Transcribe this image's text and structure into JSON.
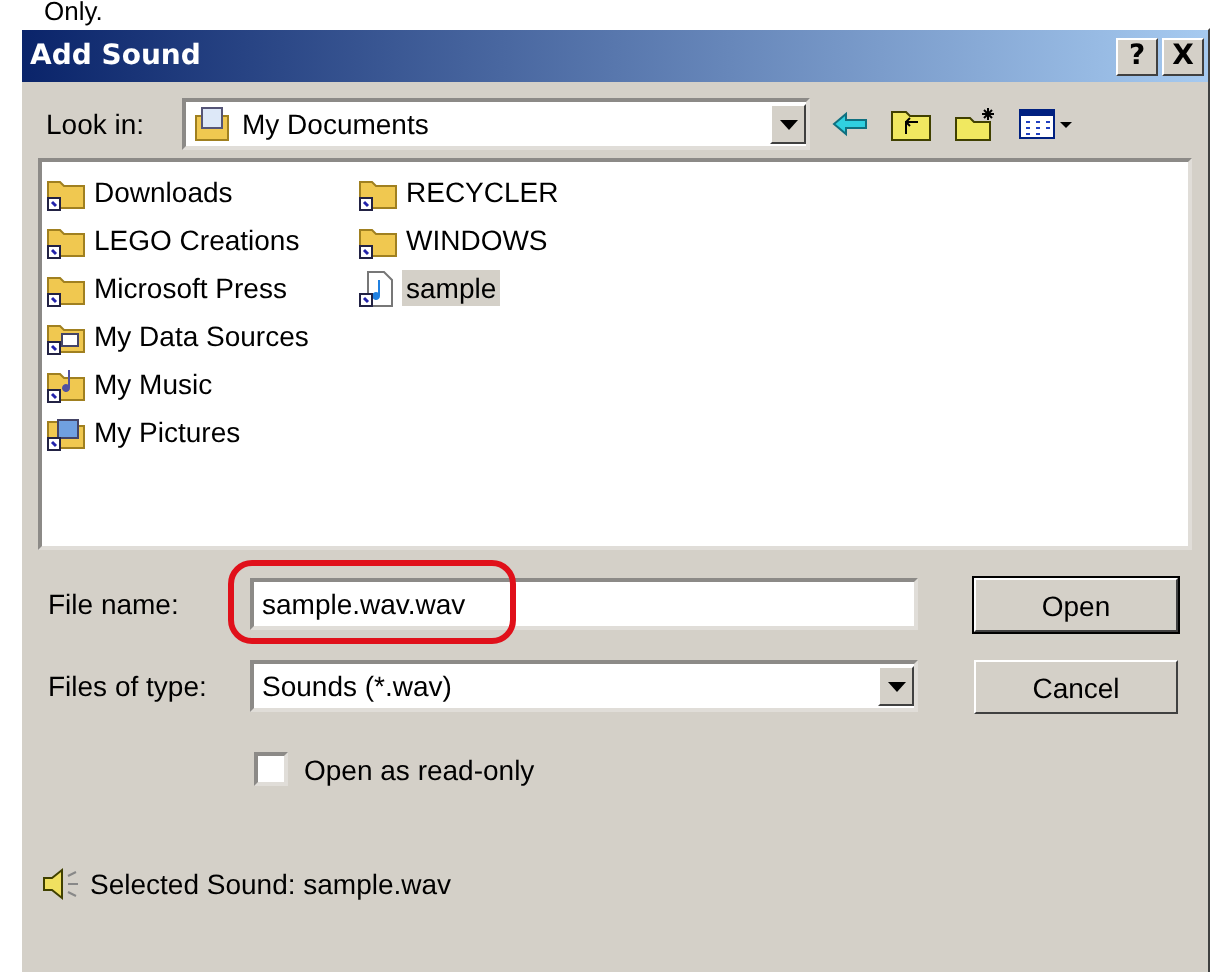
{
  "page_text": "Only.",
  "window": {
    "title": "Add Sound",
    "buttons": [
      {
        "label": "?"
      },
      {
        "label": "X"
      }
    ]
  },
  "look_in": {
    "label": "Look in:",
    "value": "My Documents"
  },
  "toolbar": [
    {
      "kind": "back"
    },
    {
      "kind": "up"
    },
    {
      "kind": "new_folder"
    },
    {
      "kind": "view_menu"
    }
  ],
  "files": [
    {
      "name": "Downloads",
      "kind": "folder",
      "selected": false
    },
    {
      "name": "LEGO Creations",
      "kind": "folder",
      "selected": false
    },
    {
      "name": "Microsoft Press",
      "kind": "folder",
      "selected": false
    },
    {
      "name": "My Data Sources",
      "kind": "data_folder",
      "selected": false
    },
    {
      "name": "My Music",
      "kind": "music_folder",
      "selected": false
    },
    {
      "name": "My Pictures",
      "kind": "pictures_folder",
      "selected": false
    },
    {
      "name": "RECYCLER",
      "kind": "folder",
      "selected": false
    },
    {
      "name": "WINDOWS",
      "kind": "folder",
      "selected": false
    },
    {
      "name": "sample",
      "kind": "sound",
      "selected": true
    }
  ],
  "file_name": {
    "label": "File name:",
    "value": "sample.wav.wav",
    "highlighted": true
  },
  "file_type": {
    "label": "Files of type:",
    "value": "Sounds (*.wav)"
  },
  "buttons": [
    {
      "label": "Open",
      "default": true
    },
    {
      "label": "Cancel",
      "default": false
    }
  ],
  "read_only": {
    "label": "Open as read-only",
    "checked": false
  },
  "status": "Selected Sound: sample.wav"
}
